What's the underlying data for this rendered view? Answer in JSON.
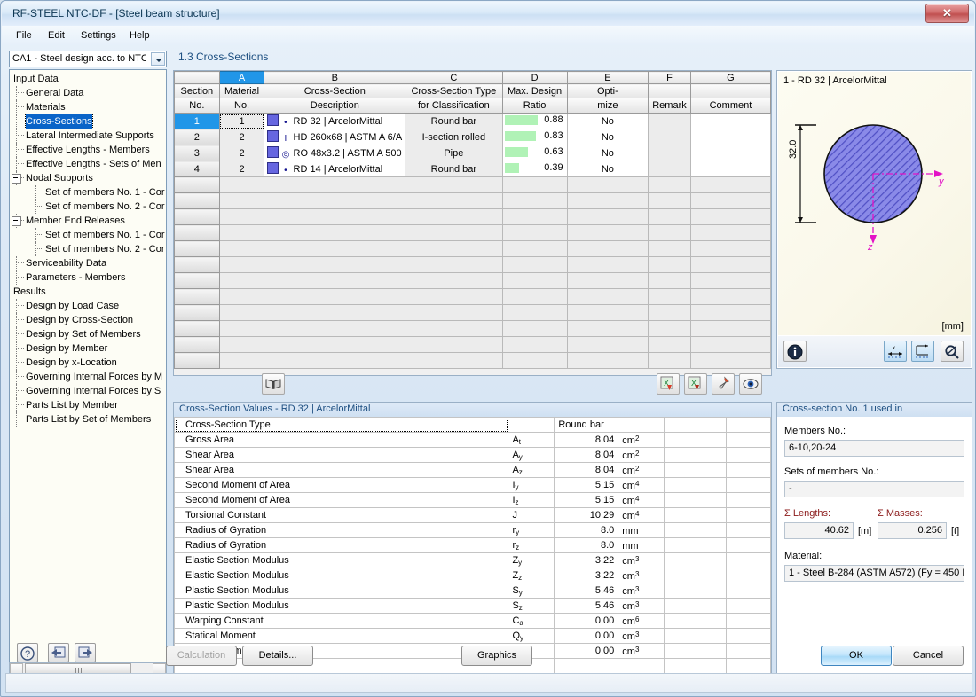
{
  "window": {
    "title": "RF-STEEL NTC-DF - [Steel beam structure]",
    "close_label": "✕"
  },
  "menu": [
    "File",
    "Edit",
    "Settings",
    "Help"
  ],
  "combo": {
    "value": "CA1 - Steel design acc. to NTC·"
  },
  "page_title": "1.3 Cross-Sections",
  "tree": {
    "items": [
      {
        "label": "Input Data",
        "depth": 0,
        "selected": false,
        "expander": false
      },
      {
        "label": "General Data",
        "depth": 1,
        "selected": false,
        "expander": false
      },
      {
        "label": "Materials",
        "depth": 1,
        "selected": false,
        "expander": false
      },
      {
        "label": "Cross-Sections",
        "depth": 1,
        "selected": true,
        "expander": false
      },
      {
        "label": "Lateral Intermediate Supports",
        "depth": 1,
        "selected": false,
        "expander": false
      },
      {
        "label": "Effective Lengths - Members",
        "depth": 1,
        "selected": false,
        "expander": false
      },
      {
        "label": "Effective Lengths - Sets of Men",
        "depth": 1,
        "selected": false,
        "expander": false
      },
      {
        "label": "Nodal Supports",
        "depth": 1,
        "selected": false,
        "expander": true
      },
      {
        "label": "Set of members No. 1 - Cor",
        "depth": 2,
        "selected": false,
        "expander": false
      },
      {
        "label": "Set of members No. 2 - Cor",
        "depth": 2,
        "selected": false,
        "expander": false
      },
      {
        "label": "Member End Releases",
        "depth": 1,
        "selected": false,
        "expander": true
      },
      {
        "label": "Set of members No. 1 - Cor",
        "depth": 2,
        "selected": false,
        "expander": false
      },
      {
        "label": "Set of members No. 2 - Cor",
        "depth": 2,
        "selected": false,
        "expander": false
      },
      {
        "label": "Serviceability Data",
        "depth": 1,
        "selected": false,
        "expander": false
      },
      {
        "label": "Parameters - Members",
        "depth": 1,
        "selected": false,
        "expander": false
      },
      {
        "label": "Results",
        "depth": 0,
        "selected": false,
        "expander": false
      },
      {
        "label": "Design by Load Case",
        "depth": 1,
        "selected": false,
        "expander": false
      },
      {
        "label": "Design by Cross-Section",
        "depth": 1,
        "selected": false,
        "expander": false
      },
      {
        "label": "Design by Set of Members",
        "depth": 1,
        "selected": false,
        "expander": false
      },
      {
        "label": "Design by Member",
        "depth": 1,
        "selected": false,
        "expander": false
      },
      {
        "label": "Design by x-Location",
        "depth": 1,
        "selected": false,
        "expander": false
      },
      {
        "label": "Governing Internal Forces by M",
        "depth": 1,
        "selected": false,
        "expander": false
      },
      {
        "label": "Governing Internal Forces by S",
        "depth": 1,
        "selected": false,
        "expander": false
      },
      {
        "label": "Parts List by Member",
        "depth": 1,
        "selected": false,
        "expander": false
      },
      {
        "label": "Parts List by Set of Members",
        "depth": 1,
        "selected": false,
        "expander": false
      }
    ]
  },
  "grid": {
    "column_letters": [
      "",
      "A",
      "B",
      "C",
      "D",
      "E",
      "F",
      "G"
    ],
    "highlight_letter": "A",
    "headers": [
      {
        "line1": "Section",
        "line2": "No."
      },
      {
        "line1": "Material",
        "line2": "No."
      },
      {
        "line1": "Cross-Section",
        "line2": "Description"
      },
      {
        "line1": "Cross-Section Type",
        "line2": "for Classification"
      },
      {
        "line1": "Max. Design",
        "line2": "Ratio"
      },
      {
        "line1": "Opti-",
        "line2": "mize"
      },
      {
        "line1": "",
        "line2": "Remark"
      },
      {
        "line1": "",
        "line2": "Comment"
      }
    ],
    "rows": [
      {
        "section": "1",
        "material": "1",
        "glyph": "•",
        "description": "RD 32 | ArcelorMittal",
        "type": "Round bar",
        "ratio": "0.88",
        "ratio_value": 0.88,
        "optimize": "No",
        "remark": "",
        "comment": "",
        "active": true
      },
      {
        "section": "2",
        "material": "2",
        "glyph": "I",
        "description": "HD 260x68 | ASTM A 6/A",
        "type": "I-section rolled",
        "ratio": "0.83",
        "ratio_value": 0.83,
        "optimize": "No",
        "remark": "",
        "comment": "",
        "active": false
      },
      {
        "section": "3",
        "material": "2",
        "glyph": "◎",
        "description": "RO 48x3.2 | ASTM A 500",
        "type": "Pipe",
        "ratio": "0.63",
        "ratio_value": 0.63,
        "optimize": "No",
        "remark": "",
        "comment": "",
        "active": false
      },
      {
        "section": "4",
        "material": "2",
        "glyph": "•",
        "description": "RD 14 | ArcelorMittal",
        "type": "Round bar",
        "ratio": "0.39",
        "ratio_value": 0.39,
        "optimize": "No",
        "remark": "",
        "comment": "",
        "active": false
      }
    ],
    "ratio_bar_color": "#b0f2b6"
  },
  "grid_toolbar": {
    "library_icon": "book-library-icon",
    "buttons": [
      "excel-import-icon",
      "excel-export-icon",
      "pin-icon",
      "view-icon"
    ]
  },
  "values_panel": {
    "title": "Cross-Section Values  -  RD 32 | ArcelorMittal",
    "rows": [
      {
        "label": "Cross-Section Type",
        "sym": "",
        "sub": "",
        "value": "Round bar",
        "unit": "",
        "unit_sup": "",
        "text_value": true
      },
      {
        "label": "Gross Area",
        "sym": "A",
        "sub": "t",
        "value": "8.04",
        "unit": "cm",
        "unit_sup": "2"
      },
      {
        "label": "Shear Area",
        "sym": "A",
        "sub": "y",
        "value": "8.04",
        "unit": "cm",
        "unit_sup": "2"
      },
      {
        "label": "Shear Area",
        "sym": "A",
        "sub": "z",
        "value": "8.04",
        "unit": "cm",
        "unit_sup": "2"
      },
      {
        "label": "Second Moment of Area",
        "sym": "I",
        "sub": "y",
        "value": "5.15",
        "unit": "cm",
        "unit_sup": "4"
      },
      {
        "label": "Second Moment of Area",
        "sym": "I",
        "sub": "z",
        "value": "5.15",
        "unit": "cm",
        "unit_sup": "4"
      },
      {
        "label": "Torsional Constant",
        "sym": "J",
        "sub": "",
        "value": "10.29",
        "unit": "cm",
        "unit_sup": "4"
      },
      {
        "label": "Radius of Gyration",
        "sym": "r",
        "sub": "y",
        "value": "8.0",
        "unit": "mm",
        "unit_sup": ""
      },
      {
        "label": "Radius of Gyration",
        "sym": "r",
        "sub": "z",
        "value": "8.0",
        "unit": "mm",
        "unit_sup": ""
      },
      {
        "label": "Elastic Section Modulus",
        "sym": "Z",
        "sub": "y",
        "value": "3.22",
        "unit": "cm",
        "unit_sup": "3"
      },
      {
        "label": "Elastic Section Modulus",
        "sym": "Z",
        "sub": "z",
        "value": "3.22",
        "unit": "cm",
        "unit_sup": "3"
      },
      {
        "label": "Plastic Section Modulus",
        "sym": "S",
        "sub": "y",
        "value": "5.46",
        "unit": "cm",
        "unit_sup": "3"
      },
      {
        "label": "Plastic Section Modulus",
        "sym": "S",
        "sub": "z",
        "value": "5.46",
        "unit": "cm",
        "unit_sup": "3"
      },
      {
        "label": "Warping Constant",
        "sym": "C",
        "sub": "a",
        "value": "0.00",
        "unit": "cm",
        "unit_sup": "6"
      },
      {
        "label": "Statical Moment",
        "sym": "Q",
        "sub": "y",
        "value": "0.00",
        "unit": "cm",
        "unit_sup": "3"
      },
      {
        "label": "Statical Moment",
        "sym": "Q",
        "sub": "z",
        "value": "0.00",
        "unit": "cm",
        "unit_sup": "3"
      },
      {
        "label": "",
        "sym": "",
        "sub": "",
        "value": "",
        "unit": "",
        "unit_sup": ""
      }
    ]
  },
  "graphic": {
    "caption": "1 - RD 32 | ArcelorMittal",
    "dimension": "32.0",
    "unit": "[mm]",
    "axis_y": "y",
    "axis_z": "z",
    "fill_color": "#7b7be0",
    "axis_color": "#e313c6",
    "buttons": [
      "info-icon",
      "dimension-x-icon",
      "dimension-offset-icon",
      "zoom-icon"
    ]
  },
  "used_in": {
    "title": "Cross-section No. 1 used in",
    "members_label": "Members No.:",
    "members_value": "6-10,20-24",
    "sets_label": "Sets of members No.:",
    "sets_value": "-",
    "lengths_label": "Σ Lengths:",
    "lengths_value": "40.62",
    "lengths_unit": "[m]",
    "masses_label": "Σ Masses:",
    "masses_value": "0.256",
    "masses_unit": "[t]",
    "material_label": "Material:",
    "material_value": "1 - Steel B-284 (ASTM A572) (Fy = 450 M"
  },
  "bottom": {
    "help_icon": "help-question-icon",
    "prev_icon": "previous-arrow-icon",
    "next_icon": "next-arrow-icon",
    "calculation": "Calculation",
    "details": "Details...",
    "graphics": "Graphics",
    "ok": "OK",
    "cancel": "Cancel"
  }
}
